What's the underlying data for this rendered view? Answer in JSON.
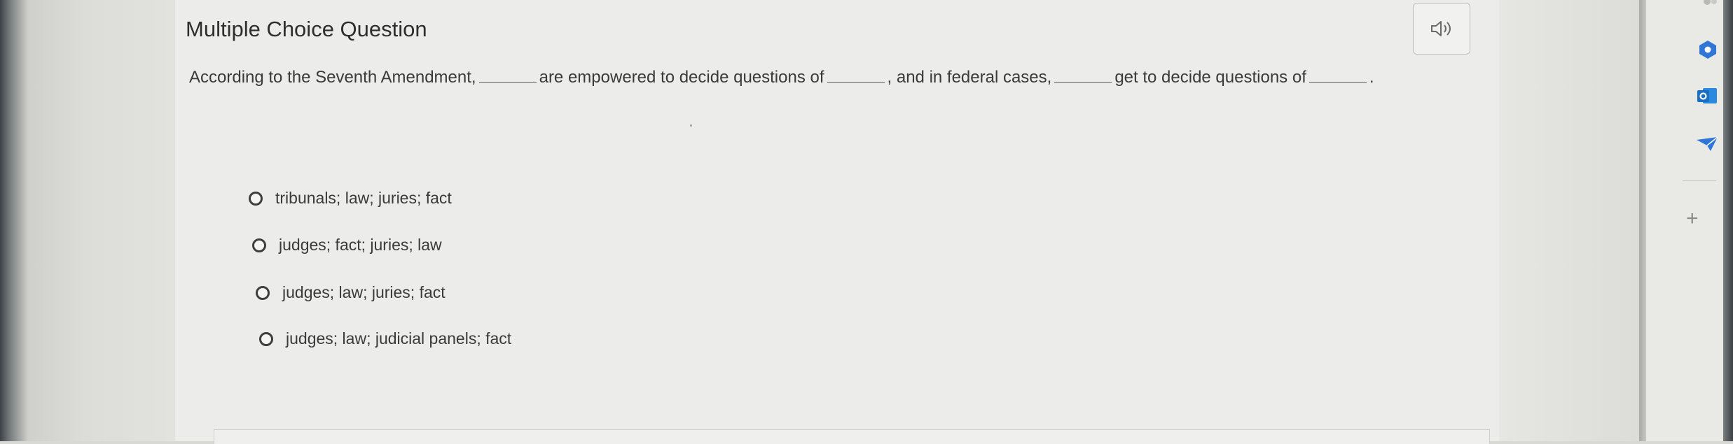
{
  "question": {
    "title": "Multiple Choice Question",
    "prompt_parts": [
      "According to the Seventh Amendment,",
      "are empowered to decide questions of",
      ", and in federal cases,",
      "get to decide questions of",
      "."
    ],
    "options": [
      "tribunals; law; juries; fact",
      "judges; fact; juries; law",
      "judges; law; juries; fact",
      "judges; law; judicial panels; fact"
    ]
  },
  "icons": {
    "audio": "speaker-icon",
    "sidebar": [
      "copilot-icon",
      "outlook-icon",
      "feedback-icon",
      "add-icon"
    ]
  },
  "sidebar": {
    "add_label": "+"
  },
  "colors": {
    "background": "#ececea",
    "text": "#3a3a3a",
    "outlook_blue": "#1b6fc2",
    "accent_blue": "#2f76d6"
  }
}
